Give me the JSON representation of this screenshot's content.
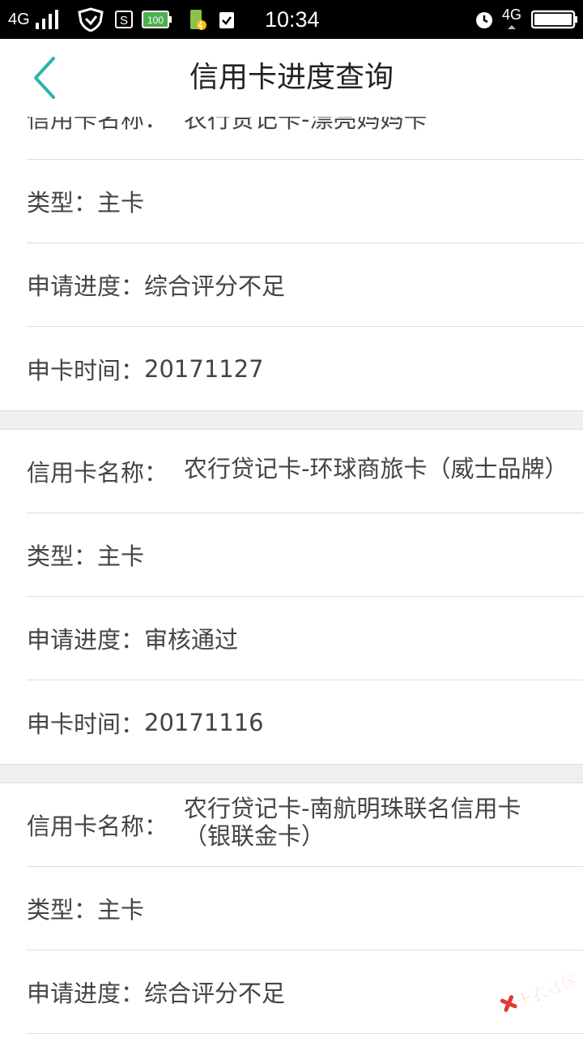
{
  "status_bar": {
    "network": "4G",
    "time": "10:34",
    "network_right": "4G",
    "battery_label": "100"
  },
  "header": {
    "title": "信用卡进度查询"
  },
  "cards": [
    {
      "rows": [
        {
          "label": "信用卡名称：",
          "value": "农行贷记卡-漂亮妈妈卡"
        },
        {
          "label": "类型：",
          "value": "主卡"
        },
        {
          "label": "申请进度：",
          "value": "综合评分不足"
        },
        {
          "label": "申卡时间：",
          "value": "20171127"
        }
      ]
    },
    {
      "rows": [
        {
          "label": "信用卡名称：",
          "value": "农行贷记卡-环球商旅卡（威士品牌）"
        },
        {
          "label": "类型：",
          "value": "主卡"
        },
        {
          "label": "申请进度：",
          "value": "审核通过"
        },
        {
          "label": "申卡时间：",
          "value": "20171116"
        }
      ]
    },
    {
      "rows": [
        {
          "label": "信用卡名称：",
          "value": "农行贷记卡-南航明珠联名信用卡（银联金卡）"
        },
        {
          "label": "类型：",
          "value": "主卡"
        },
        {
          "label": "申请进度：",
          "value": "综合评分不足"
        }
      ]
    }
  ],
  "watermark": {
    "text": "卡农社区"
  },
  "colors": {
    "accent": "#2bb5a8",
    "text": "#444444",
    "divider": "#dcdcdc",
    "gap": "#efefef",
    "watermark": "#e23a2e"
  }
}
